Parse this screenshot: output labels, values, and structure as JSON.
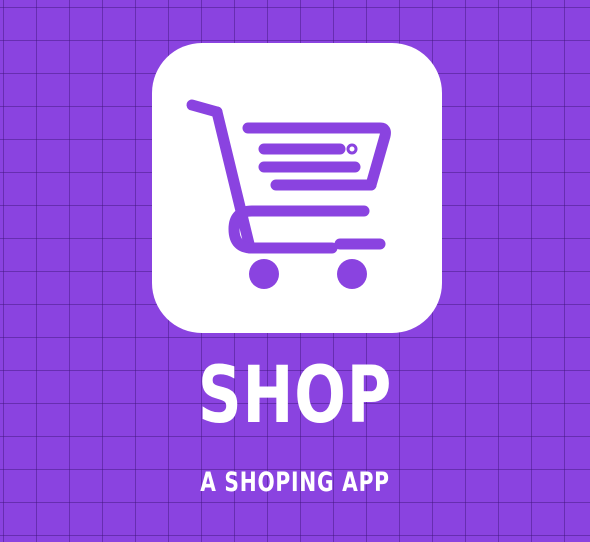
{
  "brand": {
    "title": "SHOP",
    "tagline": "A SHOPING APP"
  },
  "icon": {
    "name": "shopping-cart-icon"
  },
  "colors": {
    "background": "#8a43e0",
    "grid_lines": "#3c1478",
    "icon_tile": "#ffffff",
    "cart_stroke": "#8a43e0",
    "text": "#ffffff"
  }
}
